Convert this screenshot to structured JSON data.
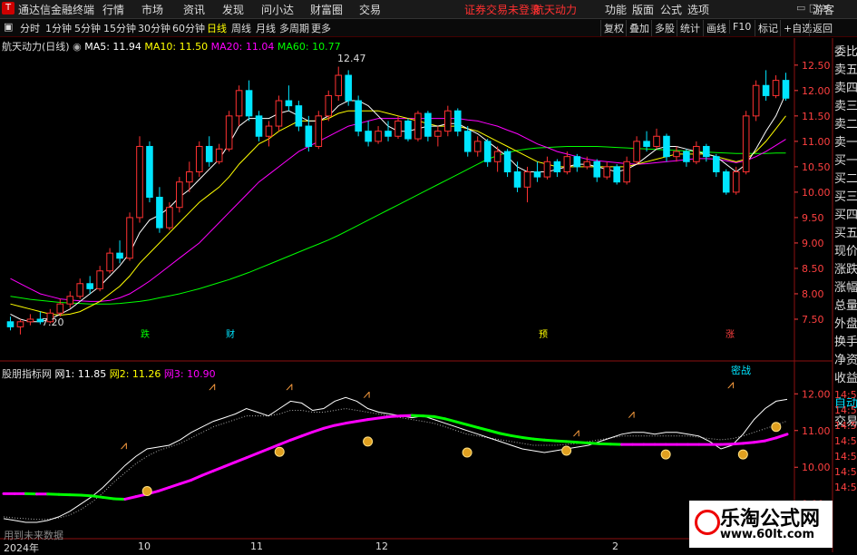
{
  "menubar": {
    "app_title": "通达信金融终端",
    "items": [
      "行情",
      "市场",
      "资讯",
      "发现",
      "问小达",
      "财富圈",
      "交易"
    ],
    "notice": "证券交易未登录",
    "stock_name": "航天动力",
    "right_items": [
      "功能",
      "版面",
      "公式",
      "选项"
    ],
    "guest": "游客"
  },
  "toolbar": {
    "periods": [
      "分时",
      "1分钟",
      "5分钟",
      "15分钟",
      "30分钟",
      "60分钟",
      "日线",
      "周线",
      "月线",
      "多周期",
      "更多"
    ],
    "active_period": "日线",
    "right_buttons": [
      "复权",
      "叠加",
      "多股",
      "统计",
      "画线",
      "F10",
      "标记",
      "+自选",
      "返回"
    ]
  },
  "sidebar": [
    "委比",
    "卖五",
    "卖四",
    "卖三",
    "卖二",
    "卖一",
    "买一",
    "买二",
    "买三",
    "买四",
    "买五",
    "现价",
    "涨跌",
    "涨幅",
    "总量",
    "外盘",
    "换手",
    "净资",
    "收益",
    "自动",
    "交易"
  ],
  "main_legend": {
    "title": "航天动力(日线)",
    "ma5": "MA5: 11.94",
    "ma10": "MA10: 11.50",
    "ma20": "MA20: 11.04",
    "ma60": "MA60: 10.77"
  },
  "sub_legend": {
    "title": "股朋指标网",
    "w1": "网1: 11.85",
    "w2": "网2: 11.26",
    "w3": "网3: 10.90"
  },
  "annotations": {
    "high_label": "12.47",
    "low_label": "7.20",
    "event_tags": [
      "跌",
      "财",
      "预",
      "涨"
    ],
    "sub_tag": "密战"
  },
  "x_labels": [
    "2024年",
    "10",
    "11",
    "12",
    "2"
  ],
  "sub_y_right_labels": [
    "14:56",
    "14:56",
    "14:56",
    "14:56",
    "14:56",
    "14:56",
    "14:56"
  ],
  "nodata_text": "用到未来数据",
  "watermark": {
    "line1": "乐淘公式网",
    "line2": "www.60lt.com"
  },
  "colors": {
    "up": "#ff3232",
    "down": "#00e5ff",
    "ma5": "#ffffff",
    "ma10": "#ffff00",
    "ma20": "#ff00ff",
    "ma60": "#00ff00",
    "axis": "#ff4040"
  },
  "chart_data": [
    {
      "type": "candlestick",
      "title": "航天动力(日线)",
      "ylim": [
        7.0,
        12.8
      ],
      "y_ticks": [
        7.5,
        8.0,
        8.5,
        9.0,
        9.5,
        10.0,
        10.5,
        11.0,
        11.5,
        12.0,
        12.5
      ],
      "ohlc": [
        [
          7.45,
          7.55,
          7.28,
          7.35
        ],
        [
          7.35,
          7.5,
          7.2,
          7.45
        ],
        [
          7.45,
          7.6,
          7.38,
          7.5
        ],
        [
          7.5,
          7.65,
          7.4,
          7.45
        ],
        [
          7.45,
          7.7,
          7.42,
          7.62
        ],
        [
          7.62,
          7.9,
          7.55,
          7.8
        ],
        [
          7.8,
          8.05,
          7.72,
          7.95
        ],
        [
          7.95,
          8.3,
          7.9,
          8.2
        ],
        [
          8.2,
          8.35,
          8.0,
          8.1
        ],
        [
          8.1,
          8.55,
          8.05,
          8.45
        ],
        [
          8.45,
          8.9,
          8.4,
          8.8
        ],
        [
          8.8,
          9.05,
          8.6,
          8.7
        ],
        [
          8.7,
          9.6,
          8.65,
          9.5
        ],
        [
          9.5,
          11.1,
          9.4,
          10.9
        ],
        [
          10.9,
          11.0,
          9.8,
          9.9
        ],
        [
          9.9,
          10.1,
          9.2,
          9.3
        ],
        [
          9.3,
          9.8,
          9.25,
          9.7
        ],
        [
          9.7,
          10.3,
          9.6,
          10.2
        ],
        [
          10.2,
          10.6,
          10.0,
          10.4
        ],
        [
          10.4,
          11.0,
          10.3,
          10.9
        ],
        [
          10.9,
          11.1,
          10.5,
          10.6
        ],
        [
          10.6,
          10.95,
          10.55,
          10.85
        ],
        [
          10.85,
          11.6,
          10.8,
          11.5
        ],
        [
          11.5,
          12.1,
          11.3,
          12.0
        ],
        [
          12.0,
          12.2,
          11.4,
          11.5
        ],
        [
          11.5,
          11.6,
          11.0,
          11.1
        ],
        [
          11.1,
          11.4,
          10.9,
          11.3
        ],
        [
          11.3,
          11.9,
          11.2,
          11.8
        ],
        [
          11.8,
          12.1,
          11.6,
          11.7
        ],
        [
          11.7,
          11.8,
          11.2,
          11.3
        ],
        [
          11.3,
          11.5,
          10.8,
          10.9
        ],
        [
          10.9,
          11.6,
          10.85,
          11.5
        ],
        [
          11.5,
          12.0,
          11.4,
          11.9
        ],
        [
          11.9,
          12.47,
          11.8,
          12.3
        ],
        [
          12.3,
          12.4,
          11.7,
          11.8
        ],
        [
          11.8,
          11.9,
          11.1,
          11.2
        ],
        [
          11.2,
          11.4,
          10.9,
          11.0
        ],
        [
          11.0,
          11.3,
          10.95,
          11.2
        ],
        [
          11.2,
          11.4,
          11.0,
          11.1
        ],
        [
          11.1,
          11.5,
          11.05,
          11.4
        ],
        [
          11.4,
          11.45,
          11.0,
          11.05
        ],
        [
          11.05,
          11.6,
          11.0,
          11.55
        ],
        [
          11.55,
          11.6,
          11.0,
          11.1
        ],
        [
          11.1,
          11.3,
          10.9,
          11.2
        ],
        [
          11.2,
          11.7,
          11.1,
          11.6
        ],
        [
          11.6,
          11.65,
          11.1,
          11.2
        ],
        [
          11.2,
          11.3,
          10.7,
          10.8
        ],
        [
          10.8,
          11.1,
          10.7,
          11.0
        ],
        [
          11.0,
          11.05,
          10.5,
          10.6
        ],
        [
          10.6,
          10.9,
          10.4,
          10.8
        ],
        [
          10.8,
          10.85,
          10.3,
          10.4
        ],
        [
          10.4,
          10.6,
          10.0,
          10.1
        ],
        [
          10.1,
          10.5,
          9.8,
          10.4
        ],
        [
          10.4,
          10.6,
          10.2,
          10.3
        ],
        [
          10.3,
          10.7,
          10.25,
          10.6
        ],
        [
          10.6,
          10.65,
          10.3,
          10.4
        ],
        [
          10.4,
          10.8,
          10.35,
          10.7
        ],
        [
          10.7,
          10.75,
          10.4,
          10.5
        ],
        [
          10.5,
          10.7,
          10.45,
          10.6
        ],
        [
          10.6,
          10.65,
          10.2,
          10.3
        ],
        [
          10.3,
          10.6,
          10.25,
          10.5
        ],
        [
          10.5,
          10.55,
          10.15,
          10.2
        ],
        [
          10.2,
          10.7,
          10.15,
          10.6
        ],
        [
          10.6,
          11.1,
          10.55,
          11.0
        ],
        [
          11.0,
          11.2,
          10.8,
          10.9
        ],
        [
          10.9,
          11.25,
          10.85,
          11.1
        ],
        [
          11.1,
          11.15,
          10.6,
          10.7
        ],
        [
          10.7,
          10.9,
          10.6,
          10.8
        ],
        [
          10.8,
          10.85,
          10.5,
          10.6
        ],
        [
          10.6,
          11.0,
          10.55,
          10.9
        ],
        [
          10.9,
          10.95,
          10.6,
          10.7
        ],
        [
          10.7,
          10.75,
          10.3,
          10.4
        ],
        [
          10.4,
          10.45,
          9.95,
          10.0
        ],
        [
          10.0,
          10.5,
          9.95,
          10.4
        ],
        [
          10.4,
          11.6,
          10.35,
          11.5
        ],
        [
          11.5,
          12.2,
          11.4,
          12.1
        ],
        [
          12.1,
          12.4,
          11.8,
          11.9
        ],
        [
          11.9,
          12.3,
          11.85,
          12.2
        ],
        [
          12.2,
          12.35,
          11.8,
          11.85
        ]
      ],
      "ma_lines": [
        {
          "name": "MA5",
          "values": [
            7.6,
            7.5,
            7.45,
            7.45,
            7.5,
            7.6,
            7.7,
            7.85,
            8.0,
            8.15,
            8.35,
            8.55,
            8.8,
            9.2,
            9.45,
            9.55,
            9.7,
            9.9,
            10.05,
            10.25,
            10.45,
            10.65,
            10.95,
            11.3,
            11.45,
            11.45,
            11.45,
            11.55,
            11.6,
            11.5,
            11.4,
            11.4,
            11.5,
            11.7,
            11.8,
            11.8,
            11.7,
            11.5,
            11.3,
            11.2,
            11.2,
            11.25,
            11.3,
            11.3,
            11.35,
            11.35,
            11.25,
            11.15,
            11.0,
            10.85,
            10.7,
            10.5,
            10.4,
            10.4,
            10.4,
            10.45,
            10.5,
            10.55,
            10.55,
            10.5,
            10.45,
            10.4,
            10.45,
            10.55,
            10.7,
            10.85,
            10.9,
            10.9,
            10.85,
            10.8,
            10.75,
            10.7,
            10.55,
            10.4,
            10.55,
            10.85,
            11.2,
            11.5,
            11.94
          ]
        },
        {
          "name": "MA10",
          "values": [
            7.8,
            7.75,
            7.7,
            7.65,
            7.6,
            7.58,
            7.6,
            7.65,
            7.75,
            7.85,
            8.0,
            8.15,
            8.35,
            8.6,
            8.8,
            9.0,
            9.2,
            9.4,
            9.6,
            9.8,
            9.95,
            10.1,
            10.3,
            10.55,
            10.75,
            10.95,
            11.05,
            11.2,
            11.3,
            11.4,
            11.4,
            11.4,
            11.45,
            11.55,
            11.6,
            11.6,
            11.6,
            11.6,
            11.55,
            11.5,
            11.45,
            11.4,
            11.35,
            11.3,
            11.3,
            11.3,
            11.25,
            11.2,
            11.1,
            11.0,
            10.9,
            10.8,
            10.7,
            10.6,
            10.55,
            10.5,
            10.5,
            10.5,
            10.5,
            10.5,
            10.5,
            10.5,
            10.5,
            10.55,
            10.6,
            10.65,
            10.7,
            10.75,
            10.75,
            10.75,
            10.75,
            10.7,
            10.65,
            10.6,
            10.65,
            10.8,
            11.0,
            11.25,
            11.5
          ]
        },
        {
          "name": "MA20",
          "values": [
            8.3,
            8.2,
            8.1,
            8.0,
            7.95,
            7.9,
            7.88,
            7.86,
            7.85,
            7.85,
            7.87,
            7.92,
            8.0,
            8.12,
            8.25,
            8.4,
            8.55,
            8.7,
            8.85,
            9.0,
            9.2,
            9.4,
            9.6,
            9.8,
            10.0,
            10.2,
            10.35,
            10.5,
            10.65,
            10.8,
            10.9,
            11.0,
            11.1,
            11.2,
            11.3,
            11.35,
            11.4,
            11.45,
            11.45,
            11.45,
            11.45,
            11.45,
            11.45,
            11.45,
            11.45,
            11.45,
            11.42,
            11.4,
            11.35,
            11.3,
            11.22,
            11.15,
            11.05,
            10.95,
            10.88,
            10.8,
            10.75,
            10.7,
            10.65,
            10.62,
            10.6,
            10.58,
            10.56,
            10.55,
            10.56,
            10.58,
            10.6,
            10.62,
            10.64,
            10.66,
            10.66,
            10.65,
            10.62,
            10.58,
            10.62,
            10.7,
            10.8,
            10.92,
            11.04
          ]
        },
        {
          "name": "MA60",
          "values": [
            7.95,
            7.92,
            7.89,
            7.87,
            7.85,
            7.83,
            7.82,
            7.81,
            7.8,
            7.8,
            7.8,
            7.81,
            7.83,
            7.85,
            7.88,
            7.92,
            7.96,
            8.0,
            8.05,
            8.1,
            8.16,
            8.22,
            8.28,
            8.35,
            8.42,
            8.5,
            8.58,
            8.66,
            8.74,
            8.82,
            8.9,
            8.98,
            9.06,
            9.15,
            9.25,
            9.35,
            9.45,
            9.55,
            9.65,
            9.75,
            9.85,
            9.95,
            10.05,
            10.15,
            10.25,
            10.35,
            10.45,
            10.55,
            10.65,
            10.72,
            10.78,
            10.82,
            10.85,
            10.87,
            10.88,
            10.89,
            10.9,
            10.9,
            10.9,
            10.9,
            10.89,
            10.88,
            10.87,
            10.86,
            10.85,
            10.84,
            10.83,
            10.82,
            10.81,
            10.8,
            10.79,
            10.78,
            10.77,
            10.76,
            10.76,
            10.76,
            10.76,
            10.77,
            10.77
          ]
        }
      ]
    },
    {
      "type": "line",
      "title": "股朋指标网",
      "ylim": [
        8.4,
        12.6
      ],
      "y_ticks": [
        9.0,
        10.0,
        11.0,
        12.0
      ],
      "series": [
        {
          "name": "网1",
          "values": [
            8.6,
            8.55,
            8.5,
            8.5,
            8.55,
            8.65,
            8.8,
            9.0,
            9.2,
            9.45,
            9.75,
            10.05,
            10.3,
            10.5,
            10.55,
            10.6,
            10.75,
            10.95,
            11.1,
            11.25,
            11.35,
            11.45,
            11.6,
            11.5,
            11.4,
            11.6,
            11.8,
            11.75,
            11.55,
            11.6,
            11.8,
            11.9,
            11.8,
            11.6,
            11.5,
            11.45,
            11.4,
            11.35,
            11.4,
            11.3,
            11.2,
            11.1,
            11.0,
            10.9,
            10.8,
            10.7,
            10.6,
            10.5,
            10.45,
            10.4,
            10.45,
            10.5,
            10.55,
            10.6,
            10.7,
            10.8,
            10.9,
            10.95,
            10.95,
            10.9,
            10.95,
            10.95,
            10.9,
            10.85,
            10.7,
            10.5,
            10.6,
            10.9,
            11.3,
            11.6,
            11.8,
            11.85
          ]
        },
        {
          "name": "网2",
          "values": [
            8.65,
            8.62,
            8.6,
            8.58,
            8.58,
            8.62,
            8.7,
            8.85,
            9.05,
            9.3,
            9.6,
            9.85,
            10.1,
            10.3,
            10.45,
            10.55,
            10.65,
            10.8,
            10.95,
            11.1,
            11.2,
            11.3,
            11.4,
            11.4,
            11.4,
            11.45,
            11.55,
            11.55,
            11.5,
            11.5,
            11.55,
            11.6,
            11.55,
            11.5,
            11.45,
            11.4,
            11.35,
            11.3,
            11.25,
            11.2,
            11.1,
            11.0,
            10.9,
            10.85,
            10.8,
            10.75,
            10.7,
            10.65,
            10.6,
            10.6,
            10.6,
            10.62,
            10.65,
            10.7,
            10.75,
            10.8,
            10.85,
            10.85,
            10.85,
            10.85,
            10.85,
            10.85,
            10.85,
            10.82,
            10.78,
            10.75,
            10.78,
            10.85,
            10.95,
            11.05,
            11.15,
            11.26
          ]
        },
        {
          "name": "网3",
          "values": [
            9.28,
            9.28,
            9.28,
            9.27,
            9.27,
            9.26,
            9.25,
            9.24,
            9.22,
            9.18,
            9.14,
            9.13,
            9.2,
            9.27,
            9.35,
            9.45,
            9.55,
            9.65,
            9.78,
            9.9,
            10.02,
            10.14,
            10.26,
            10.38,
            10.5,
            10.62,
            10.74,
            10.85,
            10.96,
            11.06,
            11.14,
            11.2,
            11.25,
            11.3,
            11.34,
            11.38,
            11.4,
            11.41,
            11.4,
            11.38,
            11.32,
            11.24,
            11.16,
            11.08,
            11.0,
            10.92,
            10.86,
            10.81,
            10.77,
            10.74,
            10.72,
            10.7,
            10.68,
            10.66,
            10.64,
            10.63,
            10.62,
            10.62,
            10.62,
            10.62,
            10.62,
            10.62,
            10.62,
            10.62,
            10.62,
            10.62,
            10.63,
            10.65,
            10.68,
            10.72,
            10.8,
            10.9
          ]
        }
      ]
    }
  ]
}
